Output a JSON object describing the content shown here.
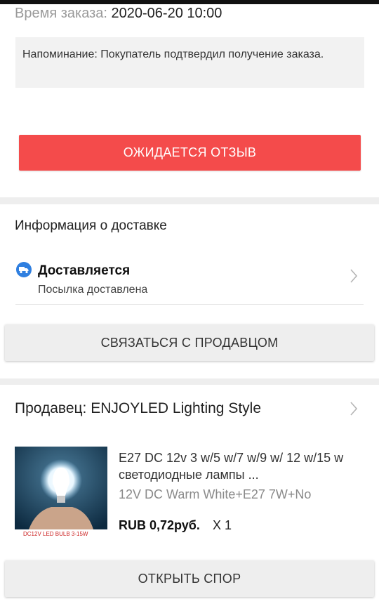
{
  "order": {
    "time_label": "Время заказа:",
    "time_value": "2020-06-20 10:00",
    "reminder": "Напоминание: Покупатель подтвердил получение заказа.",
    "review_button": "ОЖИДАЕТСЯ ОТЗЫВ"
  },
  "delivery": {
    "title": "Информация о доставке",
    "status": "Доставляется",
    "status_sub": "Посылка доставлена",
    "status_icon": "truck-icon",
    "contact_button": "СВЯЗАТЬСЯ С ПРОДАВЦОМ"
  },
  "seller": {
    "title": "Продавец: ENJOYLED Lighting Style"
  },
  "product": {
    "title": "E27 DC 12v 3 w/5 w/7 w/9 w/ 12 w/15 w светодиодные лампы ...",
    "variant": "12V DC Warm White+E27 7W+No",
    "price": "RUB 0,72руб.",
    "quantity": "X 1",
    "image_caption": "DC12V LED BULB 3-15W"
  },
  "actions": {
    "dispute_button": "ОТКРЫТЬ СПОР"
  },
  "colors": {
    "accent_red": "#f44b4b",
    "icon_blue": "#2f7fe0",
    "background": "#eeeeee"
  }
}
